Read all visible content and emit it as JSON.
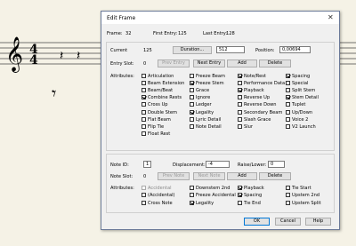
{
  "dialog": {
    "title": "Edit Frame",
    "frame_label": "Frame:",
    "frame_value": "32",
    "first_entry_label": "First Entry:",
    "first_entry_value": "125",
    "last_entry_label": "Last Entry:",
    "last_entry_value": "128"
  },
  "entry": {
    "current_label": "Current",
    "current_value": "125",
    "duration_button": "Duration...",
    "duration_value": "512",
    "position_label": "Position:",
    "position_value": "0,00694",
    "slot_label": "Entry Slot:",
    "slot_value": "0",
    "prev_entry": "Prev Entry",
    "next_entry": "Next Entry",
    "add": "Add",
    "delete": "Delete",
    "attributes_label": "Attributes:",
    "attributes": [
      [
        {
          "label": "Articulation",
          "checked": false
        },
        {
          "label": "Beam Extension",
          "checked": false
        },
        {
          "label": "Beam/Beat",
          "checked": false
        },
        {
          "label": "Combine Rests",
          "checked": true
        },
        {
          "label": "Cross Up",
          "checked": false
        },
        {
          "label": "Double Stem",
          "checked": false
        },
        {
          "label": "Flat Beam",
          "checked": false
        },
        {
          "label": "Flip Tie",
          "checked": false
        },
        {
          "label": "Float Rest",
          "checked": false
        }
      ],
      [
        {
          "label": "Freeze Beam",
          "checked": false
        },
        {
          "label": "Freeze Stem",
          "checked": true
        },
        {
          "label": "Grace",
          "checked": false
        },
        {
          "label": "Ignore",
          "checked": false
        },
        {
          "label": "Ledger",
          "checked": false
        },
        {
          "label": "Legality",
          "checked": true
        },
        {
          "label": "Lyric Detail",
          "checked": false
        },
        {
          "label": "Note Detail",
          "checked": false
        }
      ],
      [
        {
          "label": "Note/Rest",
          "checked": true
        },
        {
          "label": "Performance Data",
          "checked": false
        },
        {
          "label": "Playback",
          "checked": true
        },
        {
          "label": "Reverse Up",
          "checked": false
        },
        {
          "label": "Reverse Down",
          "checked": false
        },
        {
          "label": "Secondary Beam",
          "checked": false
        },
        {
          "label": "Slash Grace",
          "checked": false
        },
        {
          "label": "Slur",
          "checked": false
        }
      ],
      [
        {
          "label": "Spacing",
          "checked": true
        },
        {
          "label": "Special",
          "checked": false
        },
        {
          "label": "Split Stem",
          "checked": false
        },
        {
          "label": "Stem Detail",
          "checked": true
        },
        {
          "label": "Tuplet",
          "checked": false
        },
        {
          "label": "Up/Down",
          "checked": false
        },
        {
          "label": "Voice 2",
          "checked": false
        },
        {
          "label": "V2 Launch",
          "checked": false
        }
      ]
    ]
  },
  "note": {
    "id_label": "Note ID:",
    "id_value": "1",
    "displacement_label": "Displacement:",
    "displacement_value": "-4",
    "raise_label": "Raise/Lower:",
    "raise_value": "0",
    "slot_label": "Note Slot:",
    "slot_value": "0",
    "prev_note": "Prev Note",
    "next_note": "Next Note",
    "add": "Add",
    "delete": "Delete",
    "attributes_label": "Attributes:",
    "attributes": [
      [
        {
          "label": "Accidental",
          "checked": false,
          "disabled": true
        },
        {
          "label": "(Accidental)",
          "checked": false
        },
        {
          "label": "Cross Note",
          "checked": false
        }
      ],
      [
        {
          "label": "Downstem 2nd",
          "checked": false
        },
        {
          "label": "Freeze Accidental",
          "checked": false
        },
        {
          "label": "Legality",
          "checked": true
        }
      ],
      [
        {
          "label": "Playback",
          "checked": true
        },
        {
          "label": "Spacing",
          "checked": true
        },
        {
          "label": "Tie End",
          "checked": false
        }
      ],
      [
        {
          "label": "Tie Start",
          "checked": false
        },
        {
          "label": "Upstem 2nd",
          "checked": false
        },
        {
          "label": "Upstem Split",
          "checked": false
        }
      ]
    ]
  },
  "buttons": {
    "ok": "OK",
    "cancel": "Cancel",
    "help": "Help"
  },
  "score": {
    "time_top": "4",
    "time_bottom": "4"
  },
  "colors": {
    "page": "#f5f2e6",
    "dialog": "#f0f0f0",
    "focus_border": "#0078d7"
  }
}
